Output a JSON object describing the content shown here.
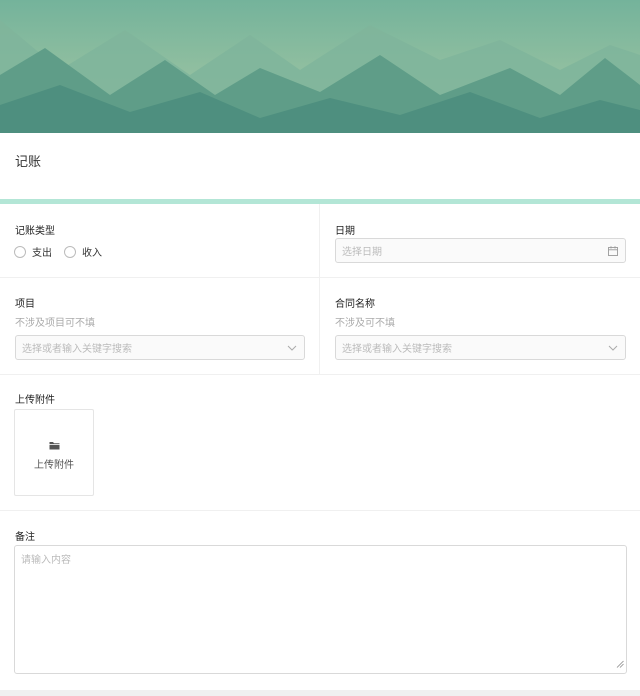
{
  "page": {
    "title": "记账"
  },
  "form": {
    "type_field": {
      "label": "记账类型",
      "options": [
        "支出",
        "收入"
      ]
    },
    "date_field": {
      "label": "日期",
      "placeholder": "选择日期"
    },
    "project_field": {
      "label": "项目",
      "hint": "不涉及项目可不填",
      "placeholder": "选择或者输入关键字搜索"
    },
    "contract_field": {
      "label": "合同名称",
      "hint": "不涉及可不填",
      "placeholder": "选择或者输入关键字搜索"
    },
    "attachment_field": {
      "label": "上传附件",
      "button_label": "上传附件"
    },
    "note_field": {
      "label": "备注",
      "placeholder": "请输入内容"
    }
  },
  "icons": {
    "date": "calendar-icon",
    "select": "chevron-down-icon",
    "upload": "folder-icon",
    "resize": "resize-handle-icon"
  },
  "colors": {
    "accent": "#b3e6d6",
    "banner_sky": "#8cc0a8",
    "banner_mountain_dark": "#4e8f7f"
  }
}
